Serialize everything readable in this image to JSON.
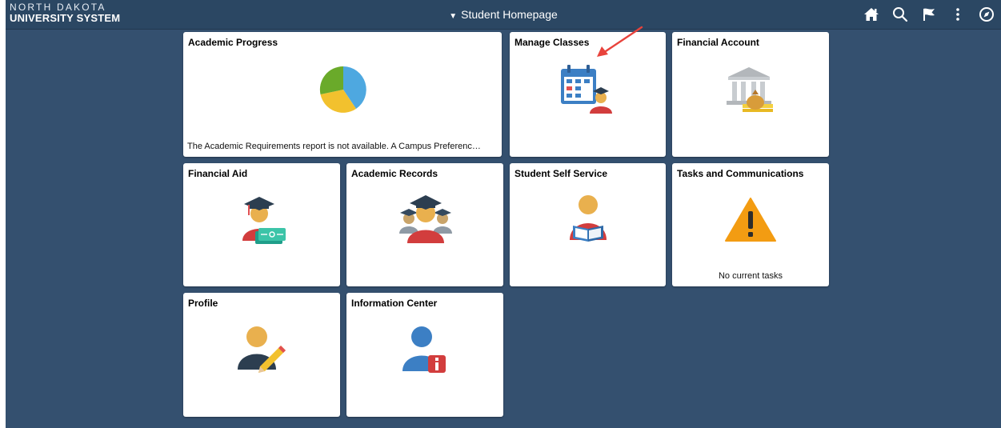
{
  "header": {
    "logo_line1": "NORTH DAKOTA",
    "logo_line2": "UNIVERSITY SYSTEM",
    "title": "Student Homepage",
    "icons": [
      "home-icon",
      "search-icon",
      "flag-icon",
      "more-options-icon",
      "navbar-compass-icon"
    ]
  },
  "colors": {
    "page_background": "#34506f",
    "header_background": "#2b4763",
    "tile_background": "#ffffff",
    "annotation_arrow": "#e8433c"
  },
  "tiles": {
    "academic_progress": {
      "title": "Academic Progress",
      "footer": "The Academic Requirements report is not available.  A Campus Preferenc…",
      "icon": "pie-chart-icon"
    },
    "manage_classes": {
      "title": "Manage Classes",
      "icon": "calendar-student-icon"
    },
    "financial_account": {
      "title": "Financial Account",
      "icon": "bank-money-icon"
    },
    "financial_aid": {
      "title": "Financial Aid",
      "icon": "graduate-money-icon"
    },
    "academic_records": {
      "title": "Academic Records",
      "icon": "graduates-group-icon"
    },
    "student_self_service": {
      "title": "Student Self Service",
      "icon": "student-reading-icon"
    },
    "tasks_communications": {
      "title": "Tasks and Communications",
      "footer": "No current tasks",
      "icon": "warning-icon"
    },
    "profile": {
      "title": "Profile",
      "icon": "person-pencil-icon"
    },
    "information_center": {
      "title": "Information Center",
      "icon": "person-info-icon"
    }
  }
}
